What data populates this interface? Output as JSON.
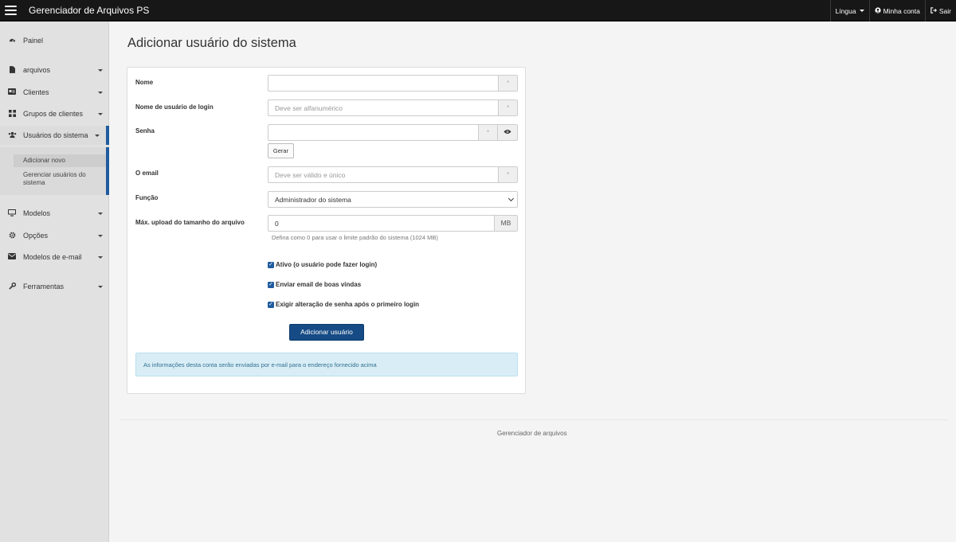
{
  "topbar": {
    "title": "Gerenciador de Arquivos PS",
    "language_label": "Língua",
    "account_label": "Minha conta",
    "logout_label": "Sair",
    "account_icon": "user-circle-icon",
    "logout_icon": "sign-out-icon"
  },
  "sidebar": {
    "items": [
      {
        "label": "Painel",
        "icon": "dashboard-icon"
      },
      {
        "label": "arquivos",
        "icon": "file-icon"
      },
      {
        "label": "Clientes",
        "icon": "address-card-icon"
      },
      {
        "label": "Grupos de clientes",
        "icon": "th-large-icon"
      },
      {
        "label": "Usuários do sistema",
        "icon": "users-icon"
      },
      {
        "label": "Modelos",
        "icon": "desktop-icon"
      },
      {
        "label": "Opções",
        "icon": "gear-icon"
      },
      {
        "label": "Modelos de e-mail",
        "icon": "envelope-icon"
      },
      {
        "label": "Ferramentas",
        "icon": "wrench-icon"
      }
    ],
    "submenu": [
      {
        "label": "Adicionar novo"
      },
      {
        "label": "Gerenciar usuários do sistema"
      }
    ]
  },
  "main": {
    "title": "Adicionar usuário do sistema",
    "form": {
      "name_label": "Nome",
      "name_value": "",
      "username_label": "Nome de usuário de login",
      "username_placeholder": "Deve ser alfanumérico",
      "password_label": "Senha",
      "password_value": "",
      "generate_label": "Gerar",
      "email_label": "O email",
      "email_placeholder": "Deve ser válido e único",
      "role_label": "Função",
      "role_value": "Administrador do sistema",
      "upload_label": "Máx. upload do tamanho do arquivo",
      "upload_value": "0",
      "upload_unit": "MB",
      "upload_help": "Defina como 0 para usar o limite padrão do sistema (1024 MB)",
      "required_mark": "*",
      "checkboxes": [
        {
          "label": "Ativo (o usuário pode fazer login)",
          "checked": true
        },
        {
          "label": "Enviar email de boas vindas",
          "checked": true
        },
        {
          "label": "Exigir alteração de senha após o primeiro login",
          "checked": true
        }
      ],
      "submit_label": "Adicionar usuário",
      "info_text": "As informações desta conta serão enviadas por e-mail para o endereço fornecido acima"
    }
  },
  "footer": {
    "text": "Gerenciador de arquivos"
  },
  "colors": {
    "topbar_bg": "#171717",
    "sidebar_bg": "#e1e1e1",
    "accent": "#1f5b9e",
    "primary_button": "#164b85",
    "alert_bg": "#d8edf6"
  }
}
